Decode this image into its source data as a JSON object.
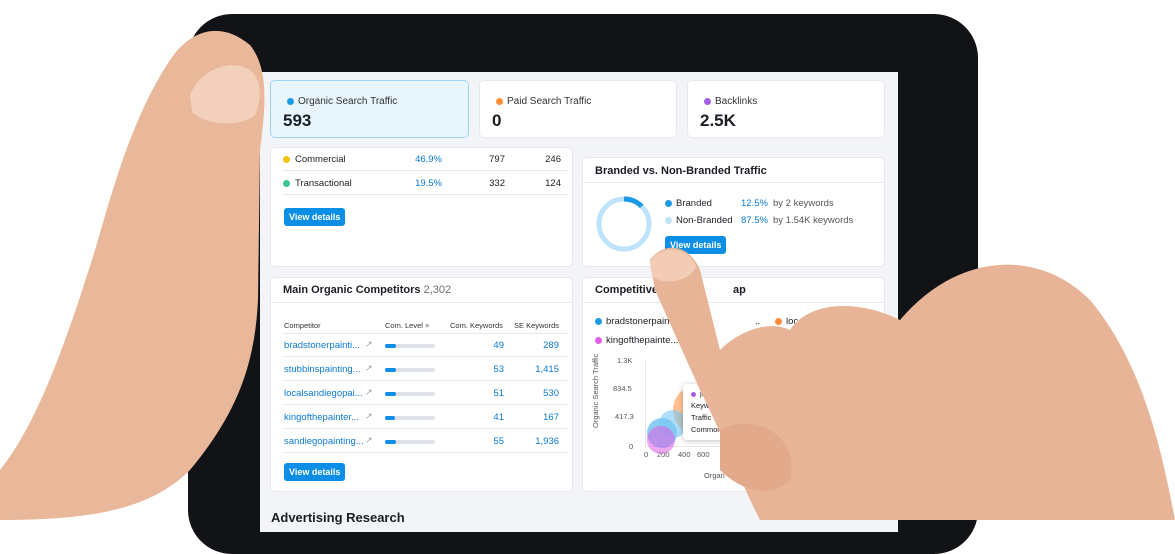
{
  "metrics": [
    {
      "label": "Organic Search Traffic",
      "value": "593",
      "color": "#1c9ae6"
    },
    {
      "label": "Paid Search Traffic",
      "value": "0",
      "color": "#ff8c36"
    },
    {
      "label": "Backlinks",
      "value": "2.5K",
      "color": "#a45ee6"
    }
  ],
  "intent": {
    "rows": [
      {
        "name": "Commercial",
        "pct": "46.9%",
        "keywords": "797",
        "traffic": "246",
        "color": "#f2c40c"
      },
      {
        "name": "Transactional",
        "pct": "19.5%",
        "keywords": "332",
        "traffic": "124",
        "color": "#3dc58f"
      }
    ],
    "button": "View details"
  },
  "branded": {
    "title": "Branded vs. Non-Branded Traffic",
    "rows": [
      {
        "name": "Branded",
        "pct": "12.5%",
        "desc": "by 2 keywords",
        "color": "#1c9ae6"
      },
      {
        "name": "Non-Branded",
        "pct": "87.5%",
        "desc": "by 1.54K keywords",
        "color": "#bde3fa"
      }
    ],
    "branded_share": 0.125,
    "button": "View details"
  },
  "competitors": {
    "title": "Main Organic Competitors",
    "count": "2,302",
    "headers": {
      "competitor": "Competitor",
      "level": "Com. Level",
      "com_keywords": "Com. Keywords",
      "se_keywords": "SE Keywords"
    },
    "rows": [
      {
        "name": "bradstonerpainti...",
        "level": 0.22,
        "com": "49",
        "se": "289"
      },
      {
        "name": "stubbinspainting...",
        "level": 0.22,
        "com": "53",
        "se": "1,415"
      },
      {
        "name": "localsandiegopai...",
        "level": 0.22,
        "com": "51",
        "se": "530"
      },
      {
        "name": "kingofthepainter...",
        "level": 0.2,
        "com": "41",
        "se": "167"
      },
      {
        "name": "sandiegopainting...",
        "level": 0.22,
        "com": "55",
        "se": "1,936"
      }
    ],
    "button": "View details"
  },
  "positioning": {
    "title_left": "Competitive",
    "title_right": "ap",
    "legend": [
      {
        "name": "bradstonerpaint...",
        "color": "#1c9ae6"
      },
      {
        "name": "..",
        "color": "#1c9ae6"
      },
      {
        "name": "loc",
        "color": "#ff8c36"
      },
      {
        "name": "kingofthepainte...",
        "color": "#e05fe6"
      },
      {
        "name": "jbro",
        "color": "#a45ee6"
      }
    ],
    "y_label": "Organic Search Traffic",
    "y_ticks": [
      "1.3K",
      "834.5",
      "417.3",
      "0"
    ],
    "x_ticks": [
      "0",
      "200",
      "400",
      "600"
    ],
    "x_label": "Organ",
    "tooltip": {
      "name": "jbrov",
      "lines": [
        "Keywords",
        "Traffic",
        "Common keyw"
      ]
    }
  },
  "section_title": "Advertising Research"
}
